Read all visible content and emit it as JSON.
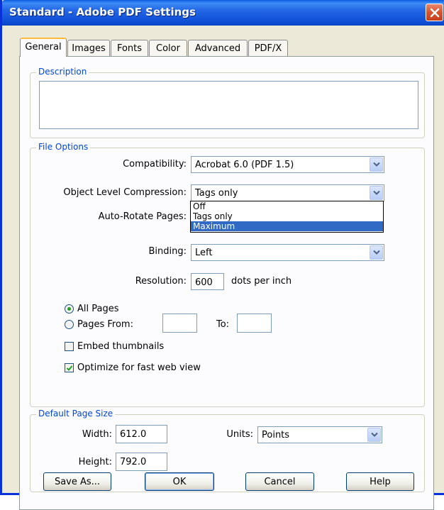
{
  "window": {
    "title": "Standard - Adobe PDF Settings"
  },
  "tabs": [
    {
      "label": "General",
      "active": true
    },
    {
      "label": "Images"
    },
    {
      "label": "Fonts"
    },
    {
      "label": "Color"
    },
    {
      "label": "Advanced"
    },
    {
      "label": "PDF/X"
    }
  ],
  "description": {
    "group_label": "Description",
    "value": ""
  },
  "file_options": {
    "group_label": "File Options",
    "compatibility": {
      "label": "Compatibility:",
      "value": "Acrobat 6.0 (PDF 1.5)"
    },
    "compression": {
      "label": "Object Level Compression:",
      "value": "Tags only",
      "options": [
        "Off",
        "Tags only",
        "Maximum"
      ],
      "highlighted": "Maximum"
    },
    "auto_rotate": {
      "label": "Auto-Rotate Pages:"
    },
    "binding": {
      "label": "Binding:",
      "value": "Left"
    },
    "resolution": {
      "label": "Resolution:",
      "value": "600",
      "units": "dots per inch"
    },
    "all_pages": {
      "label": "All Pages",
      "checked": true
    },
    "pages_from": {
      "label": "Pages From:",
      "from_value": "",
      "to_label": "To:",
      "to_value": ""
    },
    "embed_thumbnails": {
      "label": "Embed thumbnails",
      "checked": false
    },
    "optimize_web": {
      "label": "Optimize for fast web view",
      "checked": true
    }
  },
  "page_size": {
    "group_label": "Default Page Size",
    "width": {
      "label": "Width:",
      "value": "612.0"
    },
    "height": {
      "label": "Height:",
      "value": "792.0"
    },
    "units": {
      "label": "Units:",
      "value": "Points"
    }
  },
  "buttons": {
    "save_as": "Save As...",
    "ok": "OK",
    "cancel": "Cancel",
    "help": "Help"
  },
  "colors": {
    "titlebar": "#0a5ae0",
    "accent_label": "#0046d5",
    "selection": "#316ac5",
    "close": "#d8542e"
  },
  "icons": {
    "close": "close-icon",
    "dropdown": "chevron-down-icon",
    "check": "check-icon"
  }
}
